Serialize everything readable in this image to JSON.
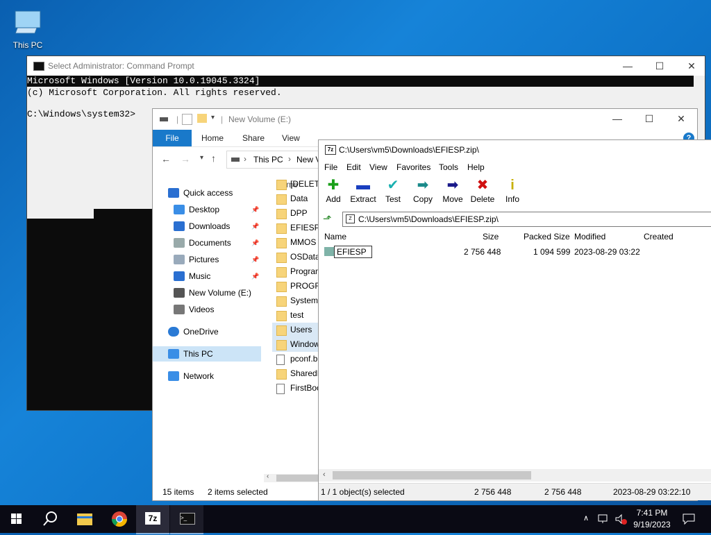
{
  "desktop": {
    "icon_label": "This PC"
  },
  "cmd": {
    "title": "Select Administrator: Command Prompt",
    "line1": "Microsoft Windows [Version 10.0.19045.3324]",
    "line2": "(c) Microsoft Corporation. All rights reserved.",
    "line3": "C:\\Windows\\system32>"
  },
  "explorer": {
    "title": "New Volume (E:)",
    "tabs": [
      "File",
      "Home",
      "Share",
      "View"
    ],
    "breadcrumb": [
      "This PC",
      "New V"
    ],
    "nav": [
      {
        "label": "Quick access",
        "icon": "star-icon",
        "pinned": false
      },
      {
        "label": "Desktop",
        "icon": "desktop-icon",
        "pinned": true
      },
      {
        "label": "Downloads",
        "icon": "download-icon",
        "pinned": true
      },
      {
        "label": "Documents",
        "icon": "documents-icon",
        "pinned": true
      },
      {
        "label": "Pictures",
        "icon": "pictures-icon",
        "pinned": true
      },
      {
        "label": "Music",
        "icon": "music-icon",
        "pinned": true
      },
      {
        "label": "New Volume (E:)",
        "icon": "drive-icon",
        "pinned": false
      },
      {
        "label": "Videos",
        "icon": "videos-icon",
        "pinned": false
      },
      {
        "label": "OneDrive",
        "icon": "cloud-icon",
        "pinned": false
      },
      {
        "label": "This PC",
        "icon": "computer-icon",
        "pinned": false,
        "selected": true
      },
      {
        "label": "Network",
        "icon": "network-icon",
        "pinned": false
      }
    ],
    "column_name": "Name",
    "files": [
      {
        "name": "[DELETE",
        "type": "folder"
      },
      {
        "name": "Data",
        "type": "folder"
      },
      {
        "name": "DPP",
        "type": "folder"
      },
      {
        "name": "EFIESP",
        "type": "folder"
      },
      {
        "name": "MMOS",
        "type": "folder"
      },
      {
        "name": "OSData",
        "type": "folder"
      },
      {
        "name": "Program",
        "type": "folder"
      },
      {
        "name": "PROGRA",
        "type": "folder"
      },
      {
        "name": "SystemD",
        "type": "folder"
      },
      {
        "name": "test",
        "type": "folder"
      },
      {
        "name": "Users",
        "type": "folder",
        "selected": true
      },
      {
        "name": "Window",
        "type": "folder",
        "selected": true
      },
      {
        "name": "pconf.b",
        "type": "file"
      },
      {
        "name": "SharedD",
        "type": "folder"
      },
      {
        "name": "FirstBoo",
        "type": "file"
      }
    ],
    "status_items": "15 items",
    "status_selected": "2 items selected"
  },
  "sevenzip": {
    "title": "C:\\Users\\vm5\\Downloads\\EFIESP.zip\\",
    "menu": [
      "File",
      "Edit",
      "View",
      "Favorites",
      "Tools",
      "Help"
    ],
    "tools": [
      {
        "label": "Add",
        "glyph": "✚",
        "color": "#1aa01a"
      },
      {
        "label": "Extract",
        "glyph": "▬",
        "color": "#1a3fbf"
      },
      {
        "label": "Test",
        "glyph": "✔",
        "color": "#1ab0b0"
      },
      {
        "label": "Copy",
        "glyph": "➡",
        "color": "#1a8a8a"
      },
      {
        "label": "Move",
        "glyph": "➡",
        "color": "#1a1a8a"
      },
      {
        "label": "Delete",
        "glyph": "✖",
        "color": "#d01010"
      },
      {
        "label": "Info",
        "glyph": "i",
        "color": "#c8b000"
      }
    ],
    "path": "C:\\Users\\vm5\\Downloads\\EFIESP.zip\\",
    "columns": [
      "Name",
      "Size",
      "Packed Size",
      "Modified",
      "Created"
    ],
    "row": {
      "name": "EFIESP",
      "size": "2 756 448",
      "packed": "1 094 599",
      "modified": "2023-08-29 03:22"
    },
    "status": {
      "selected": "1 / 1 object(s) selected",
      "size": "2 756 448",
      "packed": "2 756 448",
      "modified": "2023-08-29 03:22:10"
    }
  },
  "taskbar": {
    "time": "7:41 PM",
    "date": "9/19/2023"
  }
}
